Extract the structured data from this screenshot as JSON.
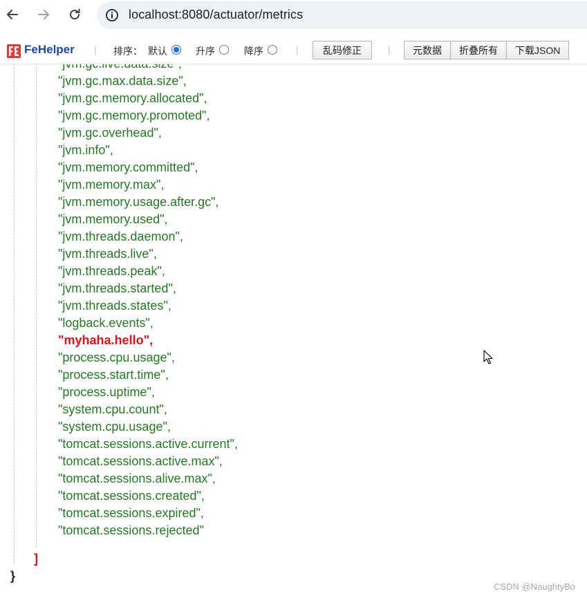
{
  "browser": {
    "url": "localhost:8080/actuator/metrics",
    "icons": [
      "back-arrow-icon",
      "forward-arrow-icon",
      "reload-icon",
      "info-icon"
    ]
  },
  "toolbar": {
    "brand": "FeHelper",
    "sort_label": "排序：",
    "sort_default": "默认",
    "sort_asc": "升序",
    "sort_desc": "降序",
    "selected_sort": "默认",
    "separator": "|",
    "fix_encoding": "乱码修正",
    "metadata": "元数据",
    "collapse_all": "折叠所有",
    "download_json": "下载JSON"
  },
  "json": {
    "lines": [
      "\"jvm.gc.live.data.size\",",
      "\"jvm.gc.max.data.size\",",
      "\"jvm.gc.memory.allocated\",",
      "\"jvm.gc.memory.promoted\",",
      "\"jvm.gc.overhead\",",
      "\"jvm.info\",",
      "\"jvm.memory.committed\",",
      "\"jvm.memory.max\",",
      "\"jvm.memory.usage.after.gc\",",
      "\"jvm.memory.used\",",
      "\"jvm.threads.daemon\",",
      "\"jvm.threads.live\",",
      "\"jvm.threads.peak\",",
      "\"jvm.threads.started\",",
      "\"jvm.threads.states\",",
      "\"logback.events\",",
      "\"myhaha.hello\",",
      "\"process.cpu.usage\",",
      "\"process.start.time\",",
      "\"process.uptime\",",
      "\"system.cpu.count\",",
      "\"system.cpu.usage\",",
      "\"tomcat.sessions.active.current\",",
      "\"tomcat.sessions.active.max\",",
      "\"tomcat.sessions.alive.max\",",
      "\"tomcat.sessions.created\",",
      "\"tomcat.sessions.expired\",",
      "\"tomcat.sessions.rejected\""
    ],
    "highlight_line": "\"myhaha.hello\",",
    "array_close": "]",
    "object_close": "}",
    "colors": {
      "string": "#237a23",
      "highlight": "#e0101a",
      "array_bracket": "#e0101a",
      "brace": "#222222"
    }
  },
  "watermark": "CSDN @NaughtyBo"
}
